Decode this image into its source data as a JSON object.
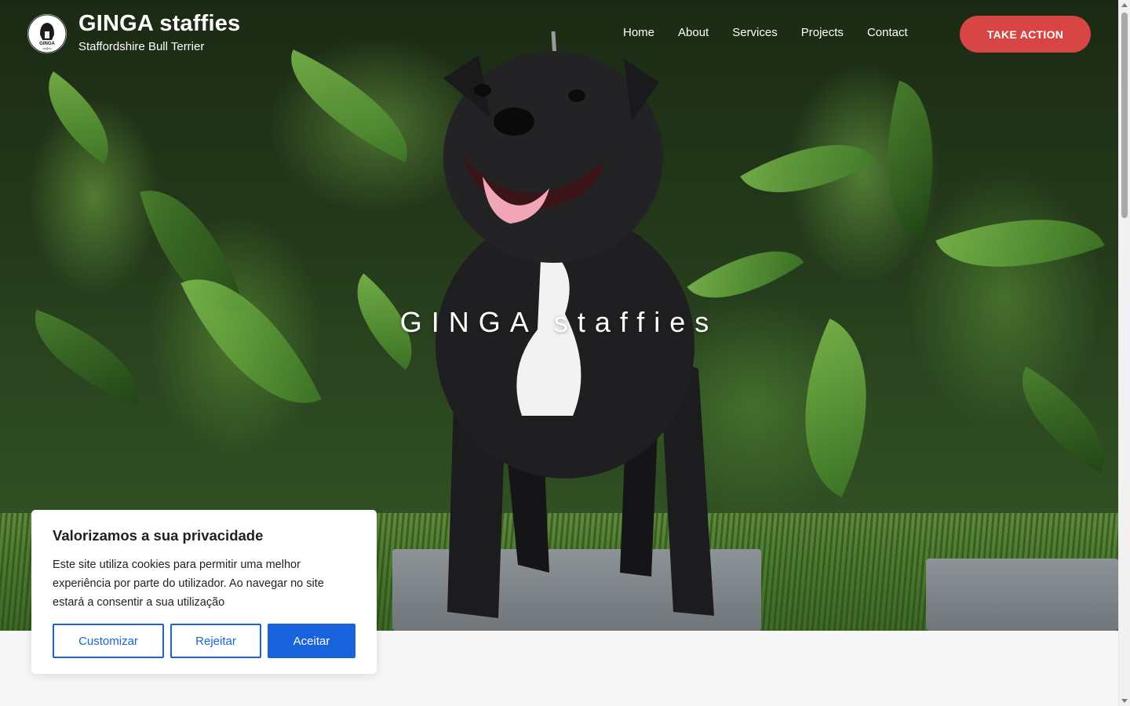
{
  "header": {
    "site_title": "GINGA staffies",
    "tagline": "Staffordshire Bull Terrier",
    "logo_text": "GINGA",
    "logo_subtext": "staffies",
    "nav": [
      {
        "label": "Home"
      },
      {
        "label": "About"
      },
      {
        "label": "Services"
      },
      {
        "label": "Projects"
      },
      {
        "label": "Contact"
      }
    ],
    "cta_label": "TAKE ACTION"
  },
  "hero": {
    "title": "GINGA staffies"
  },
  "cookie": {
    "heading": "Valorizamos a sua privacidade",
    "body": "Este site utiliza cookies para permitir uma melhor experiência por parte do utilizador. Ao navegar no site estará a consentir a sua utilização",
    "customize_label": "Customizar",
    "reject_label": "Rejeitar",
    "accept_label": "Aceitar"
  },
  "colors": {
    "cta": "#d84545",
    "cookie_accent": "#1863dc"
  }
}
